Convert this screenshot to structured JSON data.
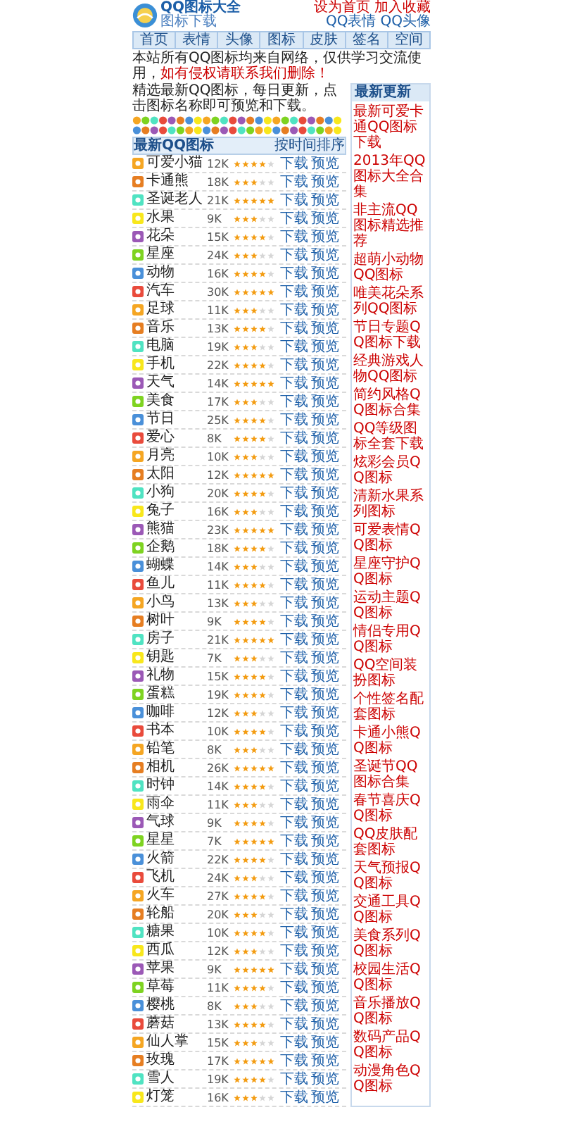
{
  "header": {
    "site_name": "QQ图标大全",
    "subtitle": "图标下载",
    "top_links": [
      "设为首页",
      "加入收藏"
    ],
    "quick_links": [
      "QQ表情",
      "QQ头像"
    ]
  },
  "nav": [
    "首页",
    "表情",
    "头像",
    "图标",
    "皮肤",
    "签名",
    "空间"
  ],
  "notice": {
    "text": "本站所有QQ图标均来自网络，仅供学习交流使用，",
    "highlight": "如有侵权请联系我们删除！"
  },
  "intro": "精选最新QQ图标，每日更新，点击图标名称即可预览和下载。",
  "table": {
    "title": "最新QQ图标",
    "sort": "按时间排序",
    "rows": [
      {
        "name": "可爱小猫",
        "size": "12K",
        "stars": 4,
        "links": [
          "下载",
          "预览"
        ]
      },
      {
        "name": "卡通熊",
        "size": "18K",
        "stars": 3,
        "links": [
          "下载",
          "预览"
        ]
      },
      {
        "name": "圣诞老人",
        "size": "21K",
        "stars": 5,
        "links": [
          "下载",
          "预览"
        ]
      },
      {
        "name": "水果",
        "size": "9K",
        "stars": 3,
        "links": [
          "下载",
          "预览"
        ]
      },
      {
        "name": "花朵",
        "size": "15K",
        "stars": 4,
        "links": [
          "下载",
          "预览"
        ]
      },
      {
        "name": "星座",
        "size": "24K",
        "stars": 3,
        "links": [
          "下载",
          "预览"
        ]
      },
      {
        "name": "动物",
        "size": "16K",
        "stars": 4,
        "links": [
          "下载",
          "预览"
        ]
      },
      {
        "name": "汽车",
        "size": "30K",
        "stars": 5,
        "links": [
          "下载",
          "预览"
        ]
      },
      {
        "name": "足球",
        "size": "11K",
        "stars": 3,
        "links": [
          "下载",
          "预览"
        ]
      },
      {
        "name": "音乐",
        "size": "13K",
        "stars": 4,
        "links": [
          "下载",
          "预览"
        ]
      },
      {
        "name": "电脑",
        "size": "19K",
        "stars": 3,
        "links": [
          "下载",
          "预览"
        ]
      },
      {
        "name": "手机",
        "size": "22K",
        "stars": 4,
        "links": [
          "下载",
          "预览"
        ]
      },
      {
        "name": "天气",
        "size": "14K",
        "stars": 5,
        "links": [
          "下载",
          "预览"
        ]
      },
      {
        "name": "美食",
        "size": "17K",
        "stars": 3,
        "links": [
          "下载",
          "预览"
        ]
      },
      {
        "name": "节日",
        "size": "25K",
        "stars": 4,
        "links": [
          "下载",
          "预览"
        ]
      },
      {
        "name": "爱心",
        "size": "8K",
        "stars": 4,
        "links": [
          "下载",
          "预览"
        ]
      },
      {
        "name": "月亮",
        "size": "10K",
        "stars": 3,
        "links": [
          "下载",
          "预览"
        ]
      },
      {
        "name": "太阳",
        "size": "12K",
        "stars": 5,
        "links": [
          "下载",
          "预览"
        ]
      },
      {
        "name": "小狗",
        "size": "20K",
        "stars": 4,
        "links": [
          "下载",
          "预览"
        ]
      },
      {
        "name": "兔子",
        "size": "16K",
        "stars": 3,
        "links": [
          "下载",
          "预览"
        ]
      },
      {
        "name": "熊猫",
        "size": "23K",
        "stars": 5,
        "links": [
          "下载",
          "预览"
        ]
      },
      {
        "name": "企鹅",
        "size": "18K",
        "stars": 4,
        "links": [
          "下载",
          "预览"
        ]
      },
      {
        "name": "蝴蝶",
        "size": "14K",
        "stars": 3,
        "links": [
          "下载",
          "预览"
        ]
      },
      {
        "name": "鱼儿",
        "size": "11K",
        "stars": 4,
        "links": [
          "下载",
          "预览"
        ]
      },
      {
        "name": "小鸟",
        "size": "13K",
        "stars": 3,
        "links": [
          "下载",
          "预览"
        ]
      },
      {
        "name": "树叶",
        "size": "9K",
        "stars": 4,
        "links": [
          "下载",
          "预览"
        ]
      },
      {
        "name": "房子",
        "size": "21K",
        "stars": 5,
        "links": [
          "下载",
          "预览"
        ]
      },
      {
        "name": "钥匙",
        "size": "7K",
        "stars": 3,
        "links": [
          "下载",
          "预览"
        ]
      },
      {
        "name": "礼物",
        "size": "15K",
        "stars": 4,
        "links": [
          "下载",
          "预览"
        ]
      },
      {
        "name": "蛋糕",
        "size": "19K",
        "stars": 4,
        "links": [
          "下载",
          "预览"
        ]
      },
      {
        "name": "咖啡",
        "size": "12K",
        "stars": 3,
        "links": [
          "下载",
          "预览"
        ]
      },
      {
        "name": "书本",
        "size": "10K",
        "stars": 4,
        "links": [
          "下载",
          "预览"
        ]
      },
      {
        "name": "铅笔",
        "size": "8K",
        "stars": 3,
        "links": [
          "下载",
          "预览"
        ]
      },
      {
        "name": "相机",
        "size": "26K",
        "stars": 5,
        "links": [
          "下载",
          "预览"
        ]
      },
      {
        "name": "时钟",
        "size": "14K",
        "stars": 4,
        "links": [
          "下载",
          "预览"
        ]
      },
      {
        "name": "雨伞",
        "size": "11K",
        "stars": 3,
        "links": [
          "下载",
          "预览"
        ]
      },
      {
        "name": "气球",
        "size": "9K",
        "stars": 4,
        "links": [
          "下载",
          "预览"
        ]
      },
      {
        "name": "星星",
        "size": "7K",
        "stars": 5,
        "links": [
          "下载",
          "预览"
        ]
      },
      {
        "name": "火箭",
        "size": "22K",
        "stars": 4,
        "links": [
          "下载",
          "预览"
        ]
      },
      {
        "name": "飞机",
        "size": "24K",
        "stars": 3,
        "links": [
          "下载",
          "预览"
        ]
      },
      {
        "name": "火车",
        "size": "27K",
        "stars": 4,
        "links": [
          "下载",
          "预览"
        ]
      },
      {
        "name": "轮船",
        "size": "20K",
        "stars": 3,
        "links": [
          "下载",
          "预览"
        ]
      },
      {
        "name": "糖果",
        "size": "10K",
        "stars": 4,
        "links": [
          "下载",
          "预览"
        ]
      },
      {
        "name": "西瓜",
        "size": "12K",
        "stars": 3,
        "links": [
          "下载",
          "预览"
        ]
      },
      {
        "name": "苹果",
        "size": "9K",
        "stars": 5,
        "links": [
          "下载",
          "预览"
        ]
      },
      {
        "name": "草莓",
        "size": "11K",
        "stars": 4,
        "links": [
          "下载",
          "预览"
        ]
      },
      {
        "name": "樱桃",
        "size": "8K",
        "stars": 3,
        "links": [
          "下载",
          "预览"
        ]
      },
      {
        "name": "蘑菇",
        "size": "13K",
        "stars": 4,
        "links": [
          "下载",
          "预览"
        ]
      },
      {
        "name": "仙人掌",
        "size": "15K",
        "stars": 3,
        "links": [
          "下载",
          "预览"
        ]
      },
      {
        "name": "玫瑰",
        "size": "17K",
        "stars": 5,
        "links": [
          "下载",
          "预览"
        ]
      },
      {
        "name": "雪人",
        "size": "19K",
        "stars": 4,
        "links": [
          "下载",
          "预览"
        ]
      },
      {
        "name": "灯笼",
        "size": "16K",
        "stars": 3,
        "links": [
          "下载",
          "预览"
        ]
      }
    ]
  },
  "sidebar": {
    "title": "最新更新",
    "items": [
      "最新可爱卡通QQ图标下载",
      "2013年QQ图标大全合集",
      "非主流QQ图标精选推荐",
      "超萌小动物QQ图标",
      "唯美花朵系列QQ图标",
      "节日专题QQ图标下载",
      "经典游戏人物QQ图标",
      "简约风格QQ图标合集",
      "QQ等级图标全套下载",
      "炫彩会员QQ图标",
      "清新水果系列图标",
      "可爱表情QQ图标",
      "星座守护QQ图标",
      "运动主题QQ图标",
      "情侣专用QQ图标",
      "QQ空间装扮图标",
      "个性签名配套图标",
      "卡通小熊QQ图标",
      "圣诞节QQ图标合集",
      "春节喜庆QQ图标",
      "QQ皮肤配套图标",
      "天气预报QQ图标",
      "交通工具QQ图标",
      "美食系列QQ图标",
      "校园生活QQ图标",
      "音乐播放QQ图标",
      "数码产品QQ图标",
      "动漫角色QQ图标"
    ]
  }
}
